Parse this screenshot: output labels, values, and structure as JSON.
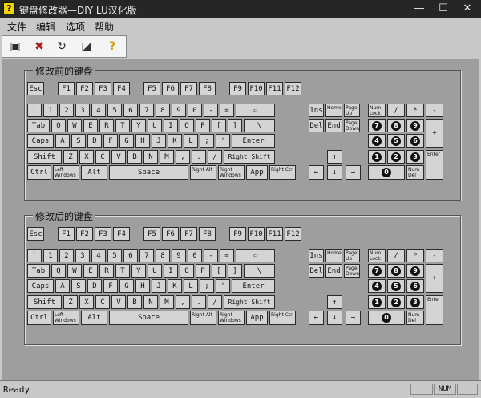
{
  "window": {
    "title": "键盘修改器—DIY   LU汉化版",
    "minimize": "—",
    "maximize": "☐",
    "close": "✕",
    "app_icon_glyph": "?"
  },
  "menu": [
    {
      "label": "文件"
    },
    {
      "label": "编辑"
    },
    {
      "label": "选项"
    },
    {
      "label": "帮助"
    }
  ],
  "toolbar": [
    {
      "name": "open",
      "glyph": "▣",
      "icon": "open-keyboard-icon"
    },
    {
      "name": "delete",
      "glyph": "✖",
      "icon": "delete-icon"
    },
    {
      "name": "reset",
      "glyph": "↻",
      "icon": "reset-icon"
    },
    {
      "name": "view",
      "glyph": "◪",
      "icon": "view-icon"
    },
    {
      "name": "help",
      "glyph": "?",
      "icon": "help-icon"
    }
  ],
  "groups": [
    {
      "title": "修改前的键盘"
    },
    {
      "title": "修改后的键盘"
    }
  ],
  "keys": {
    "esc": "Esc",
    "f1": "F1",
    "f2": "F2",
    "f3": "F3",
    "f4": "F4",
    "f5": "F5",
    "f6": "F6",
    "f7": "F7",
    "f8": "F8",
    "f9": "F9",
    "f10": "F10",
    "f11": "F11",
    "f12": "F12",
    "grave": "`",
    "d1": "1",
    "d2": "2",
    "d3": "3",
    "d4": "4",
    "d5": "5",
    "d6": "6",
    "d7": "7",
    "d8": "8",
    "d9": "9",
    "d0": "0",
    "minus": "-",
    "equal": "=",
    "backspace": "⇦",
    "tab": "Tab",
    "q": "Q",
    "w": "W",
    "e": "E",
    "r": "R",
    "t": "T",
    "y": "Y",
    "u": "U",
    "i": "I",
    "o": "O",
    "p": "P",
    "lbracket": "[",
    "rbracket": "]",
    "backslash": "\\",
    "caps": "Caps",
    "a": "A",
    "s": "S",
    "d": "D",
    "f": "F",
    "g": "G",
    "h": "H",
    "j": "J",
    "k": "K",
    "l": "L",
    "semicolon": ";",
    "quote": "'",
    "enter": "Enter",
    "shift": "Shift",
    "z": "Z",
    "x": "X",
    "c": "C",
    "v": "V",
    "b": "B",
    "n": "N",
    "m": "M",
    "comma": ",",
    "period": ".",
    "slash": "/",
    "rshift": "Right Shift",
    "ctrl": "Ctrl",
    "lwin": "Left Windows",
    "alt": "Alt",
    "space": "Space",
    "ralt": "Right Alt",
    "rwin": "Right Windows",
    "app": "App",
    "rctrl": "Right Ctrl",
    "ins": "Ins",
    "home": "Home",
    "pgup": "Page Up",
    "del": "Del",
    "end": "End",
    "pgdn": "Page Down",
    "up": "↑",
    "left": "←",
    "down": "↓",
    "right": "→",
    "numlock": "Num Lock",
    "ndiv": "/",
    "nmul": "*",
    "nminus": "-",
    "nplus": "+",
    "nenter": "Enter",
    "n7": "7",
    "n8": "8",
    "n9": "9",
    "n4": "4",
    "n5": "5",
    "n6": "6",
    "n1": "1",
    "n2": "2",
    "n3": "3",
    "n0": "0",
    "ndel": "Num Del"
  },
  "status": {
    "text": "Ready",
    "num": "NUM"
  }
}
